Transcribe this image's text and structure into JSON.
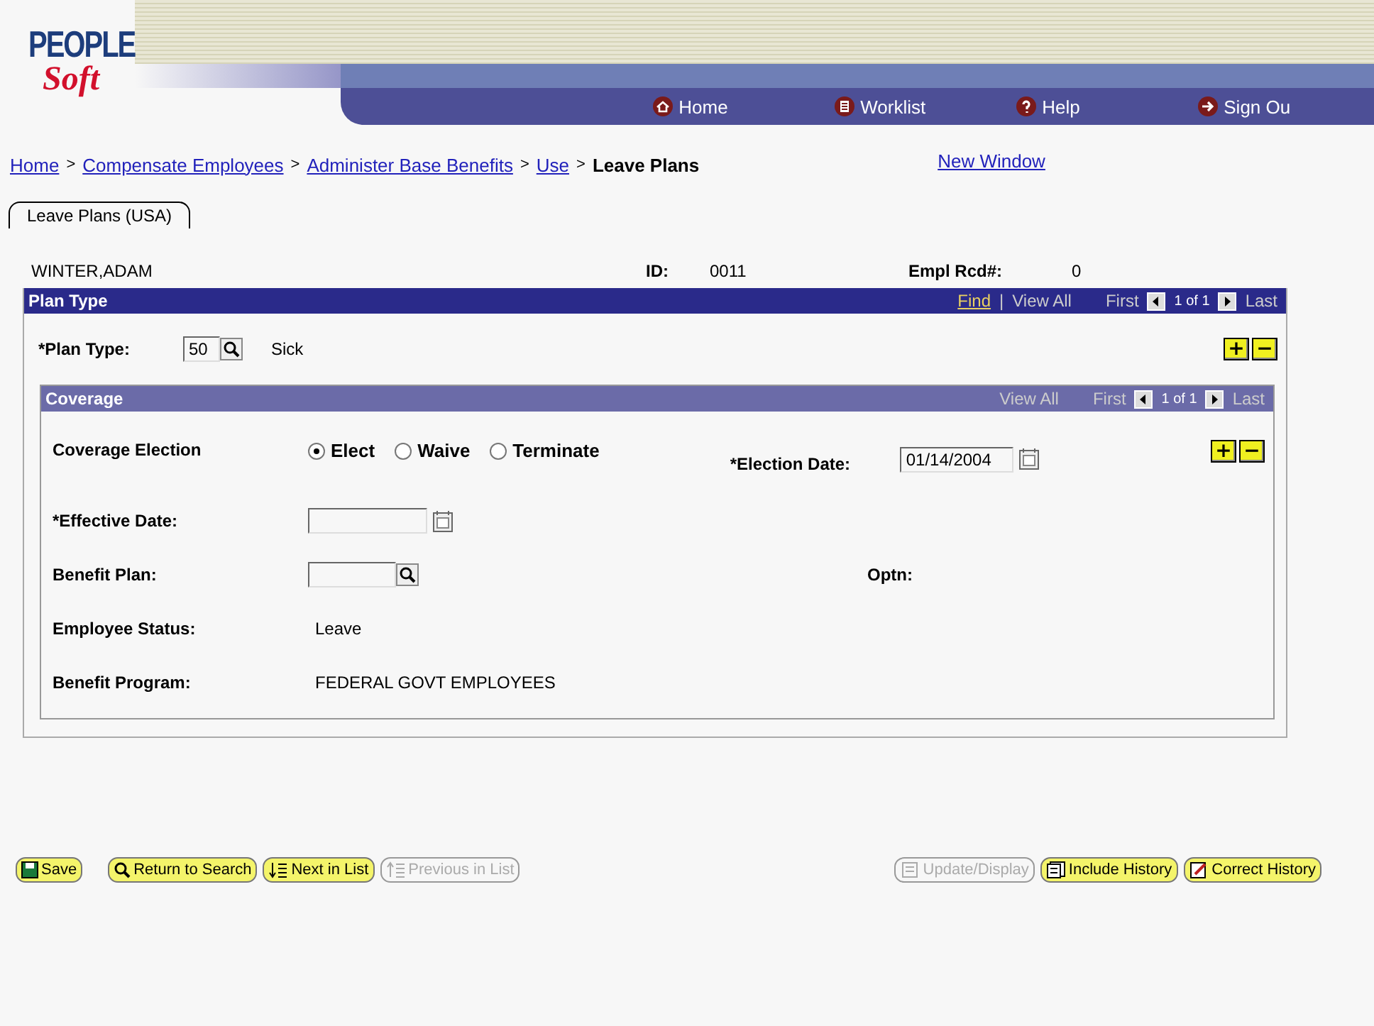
{
  "logo": {
    "line1": "PEOPLE",
    "line2": "Soft"
  },
  "nav": [
    {
      "label": "Home"
    },
    {
      "label": "Worklist"
    },
    {
      "label": "Help"
    },
    {
      "label": "Sign Ou"
    }
  ],
  "breadcrumb": [
    {
      "label": "Home",
      "link": true
    },
    {
      "label": "Compensate Employees",
      "link": true
    },
    {
      "label": "Administer Base Benefits",
      "link": true
    },
    {
      "label": "Use",
      "link": true
    },
    {
      "label": "Leave Plans",
      "link": false
    }
  ],
  "breadcrumb_separator": ">",
  "new_window": "New Window",
  "tabs": [
    {
      "label": "Leave Plans (USA)",
      "selected": true
    }
  ],
  "employee": {
    "name": "WINTER,ADAM",
    "id_label": "ID:",
    "id": "0011",
    "rcd_label": "Empl Rcd#:",
    "rcd": "0"
  },
  "plan_type": {
    "title": "Plan Type",
    "find": "Find",
    "separator": "|",
    "view_all": "View All",
    "first": "First",
    "count": "1 of 1",
    "last": "Last",
    "label": "*Plan Type:",
    "value": "50",
    "description": "Sick",
    "add": "+",
    "remove": "−"
  },
  "coverage": {
    "title": "Coverage",
    "view_all": "View All",
    "first": "First",
    "count": "1 of 1",
    "last": "Last",
    "add": "+",
    "remove": "−",
    "election_label": "Coverage Election",
    "options": [
      {
        "label": "Elect",
        "selected": true
      },
      {
        "label": "Waive",
        "selected": false
      },
      {
        "label": "Terminate",
        "selected": false
      }
    ],
    "election_date_label": "*Election Date:",
    "election_date": "01/14/2004",
    "effective_date_label": "*Effective Date:",
    "benefit_plan_label": "Benefit Plan:",
    "optn_label": "Optn:",
    "status_label": "Employee Status:",
    "status": "Leave",
    "program_label": "Benefit Program:",
    "program": "FEDERAL GOVT EMPLOYEES"
  },
  "buttons_left": [
    {
      "label": "Save",
      "disabled": false
    },
    {
      "label": "Return to Search",
      "disabled": false
    },
    {
      "label": "Next in List",
      "disabled": false
    },
    {
      "label": "Previous in List",
      "disabled": true
    }
  ],
  "buttons_right": [
    {
      "label": "Update/Display",
      "disabled": true
    },
    {
      "label": "Include History",
      "disabled": false
    },
    {
      "label": "Correct History",
      "disabled": false
    }
  ]
}
